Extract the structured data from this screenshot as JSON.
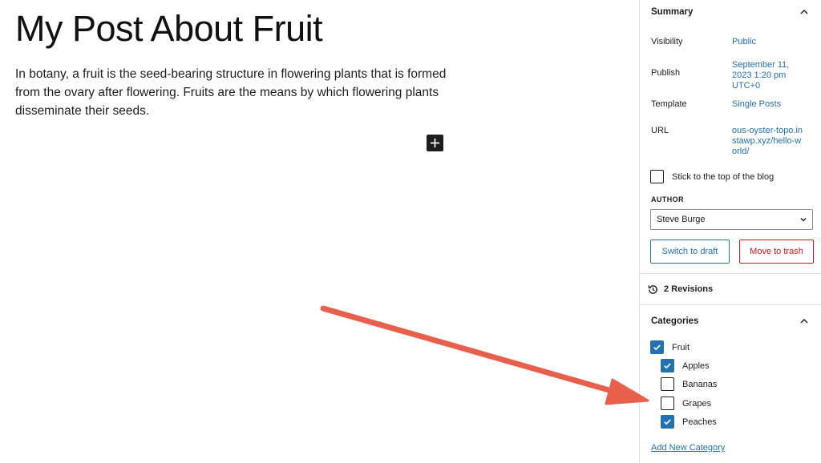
{
  "post": {
    "title": "My Post About Fruit",
    "body": "In botany, a fruit is the seed-bearing structure in flowering plants that is formed from the ovary after flowering. Fruits are the means by which flowering plants disseminate their seeds."
  },
  "sidebar": {
    "summary": {
      "heading": "Summary",
      "visibility_label": "Visibility",
      "visibility_value": "Public",
      "publish_label": "Publish",
      "publish_value": "September 11, 2023 1:20 pm UTC+0",
      "template_label": "Template",
      "template_value": "Single Posts",
      "url_label": "URL",
      "url_value": "ous-oyster-topo.instawp.xyz/hello-world/",
      "sticky_label": "Stick to the top of the blog",
      "sticky_checked": false,
      "author_label": "AUTHOR",
      "author_value": "Steve Burge",
      "switch_draft": "Switch to draft",
      "move_trash": "Move to trash"
    },
    "revisions": "2 Revisions",
    "categories": {
      "heading": "Categories",
      "items": [
        {
          "label": "Fruit",
          "checked": true,
          "level": 0
        },
        {
          "label": "Apples",
          "checked": true,
          "level": 1
        },
        {
          "label": "Bananas",
          "checked": false,
          "level": 1
        },
        {
          "label": "Grapes",
          "checked": false,
          "level": 1
        },
        {
          "label": "Peaches",
          "checked": true,
          "level": 1
        }
      ],
      "add_new": "Add New Category"
    }
  },
  "colors": {
    "accent": "#2271b1",
    "danger": "#cc1818",
    "annotation_arrow": "#e8604c"
  }
}
